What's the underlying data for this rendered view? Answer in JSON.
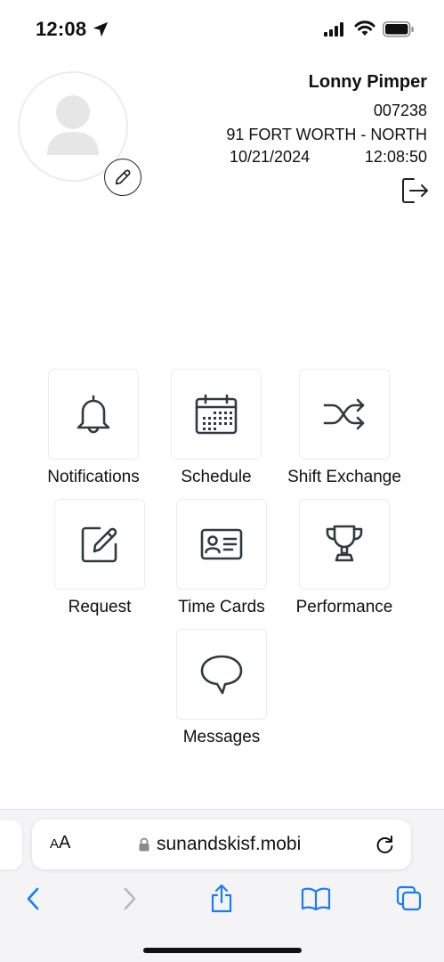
{
  "status_bar": {
    "time": "12:08",
    "icons": [
      "location-arrow-icon",
      "cellular-signal-icon",
      "wifi-icon",
      "battery-icon"
    ]
  },
  "profile": {
    "avatar_icon": "user-placeholder-icon",
    "edit_icon": "pencil-icon",
    "name": "Lonny Pimper",
    "employee_id": "007238",
    "location": "91 FORT WORTH - NORTH",
    "date": "10/21/2024",
    "time": "12:08:50",
    "logout_icon": "logout-icon"
  },
  "menu": {
    "notifications": {
      "label": "Notifications",
      "icon": "bell-icon"
    },
    "schedule": {
      "label": "Schedule",
      "icon": "calendar-icon"
    },
    "shift_exchange": {
      "label": "Shift Exchange",
      "icon": "shuffle-icon"
    },
    "request": {
      "label": "Request",
      "icon": "edit-square-icon"
    },
    "time_cards": {
      "label": "Time Cards",
      "icon": "id-card-icon"
    },
    "performance": {
      "label": "Performance",
      "icon": "trophy-icon"
    },
    "messages": {
      "label": "Messages",
      "icon": "chat-bubble-icon"
    }
  },
  "browser": {
    "aa_large": "A",
    "aa_small": "A",
    "url": "sunandskisf.mobi",
    "toolbar_icons": [
      "back-icon",
      "forward-icon",
      "share-icon",
      "bookmarks-icon",
      "tabs-icon"
    ]
  },
  "colors": {
    "icon": "#2f3a3f",
    "safari_blue": "#1a7cf5",
    "disabled": "#b9b9bd",
    "tile_border": "#ececec"
  }
}
